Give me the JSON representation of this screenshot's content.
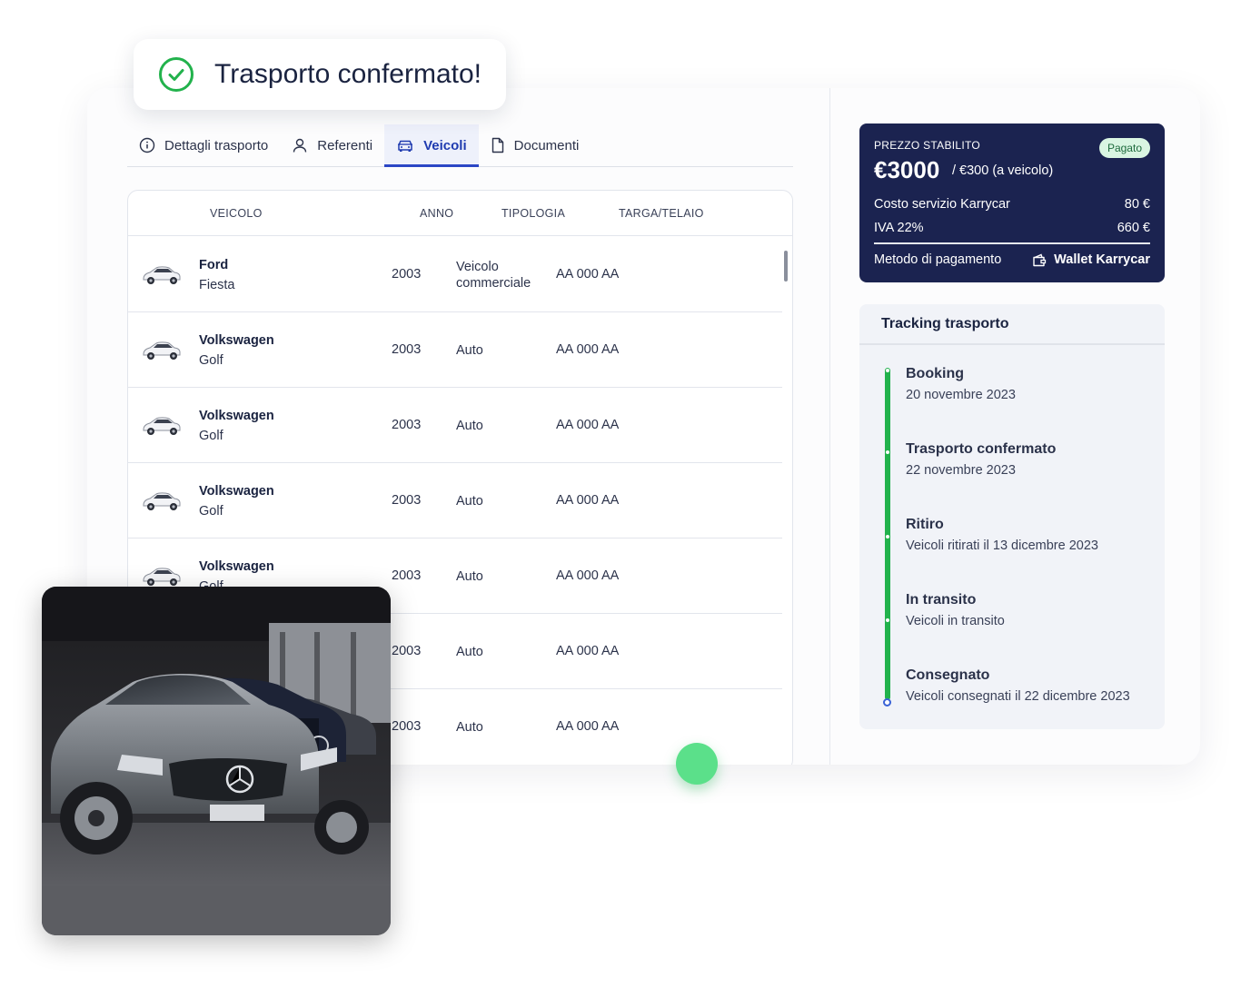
{
  "toast": {
    "message": "Trasporto confermato!",
    "icon": "check-circle-icon"
  },
  "tabs": [
    {
      "label": "Dettagli trasporto",
      "icon": "info-icon",
      "active": false
    },
    {
      "label": "Referenti",
      "icon": "user-icon",
      "active": false
    },
    {
      "label": "Veicoli",
      "icon": "car-icon",
      "active": true
    },
    {
      "label": "Documenti",
      "icon": "document-icon",
      "active": false
    }
  ],
  "table": {
    "headers": {
      "vehicle": "VEICOLO",
      "year": "ANNO",
      "type": "TIPOLOGIA",
      "plate": "TARGA/TELAIO"
    },
    "rows": [
      {
        "brand": "Ford",
        "model": "Fiesta",
        "year": "2003",
        "type": "Veicolo commerciale",
        "plate": "AA 000 AA"
      },
      {
        "brand": "Volkswagen",
        "model": "Golf",
        "year": "2003",
        "type": "Auto",
        "plate": "AA 000 AA"
      },
      {
        "brand": "Volkswagen",
        "model": "Golf",
        "year": "2003",
        "type": "Auto",
        "plate": "AA 000 AA"
      },
      {
        "brand": "Volkswagen",
        "model": "Golf",
        "year": "2003",
        "type": "Auto",
        "plate": "AA 000 AA"
      },
      {
        "brand": "Volkswagen",
        "model": "Golf",
        "year": "2003",
        "type": "Auto",
        "plate": "AA 000 AA"
      },
      {
        "brand": "",
        "model": "",
        "year": "2003",
        "type": "Auto",
        "plate": "AA 000 AA"
      },
      {
        "brand": "",
        "model": "",
        "year": "2003",
        "type": "Auto",
        "plate": "AA 000 AA"
      }
    ]
  },
  "price": {
    "label": "PREZZO STABILITO",
    "status_badge": "Pagato",
    "total": "€3000",
    "per_vehicle": "/ €300 (a veicolo)",
    "service_label": "Costo servizio Karrycar",
    "service_value": "80 €",
    "vat_label": "IVA 22%",
    "vat_value": "660 €",
    "payment_method_label": "Metodo di pagamento",
    "payment_method_value": "Wallet Karrycar"
  },
  "tracking": {
    "title": "Tracking trasporto",
    "steps": [
      {
        "title": "Booking",
        "detail": "20 novembre 2023"
      },
      {
        "title": "Trasporto confermato",
        "detail": "22 novembre 2023"
      },
      {
        "title": "Ritiro",
        "detail": "Veicoli ritirati il 13 dicembre 2023"
      },
      {
        "title": "In transito",
        "detail": "Veicoli in transito"
      },
      {
        "title": "Consegnato",
        "detail": "Veicoli consegnati il 22 dicembre 2023"
      }
    ]
  },
  "colors": {
    "navy": "#1b2350",
    "accent": "#2b46c5",
    "success": "#22b24c",
    "dot": "#5be08a"
  }
}
